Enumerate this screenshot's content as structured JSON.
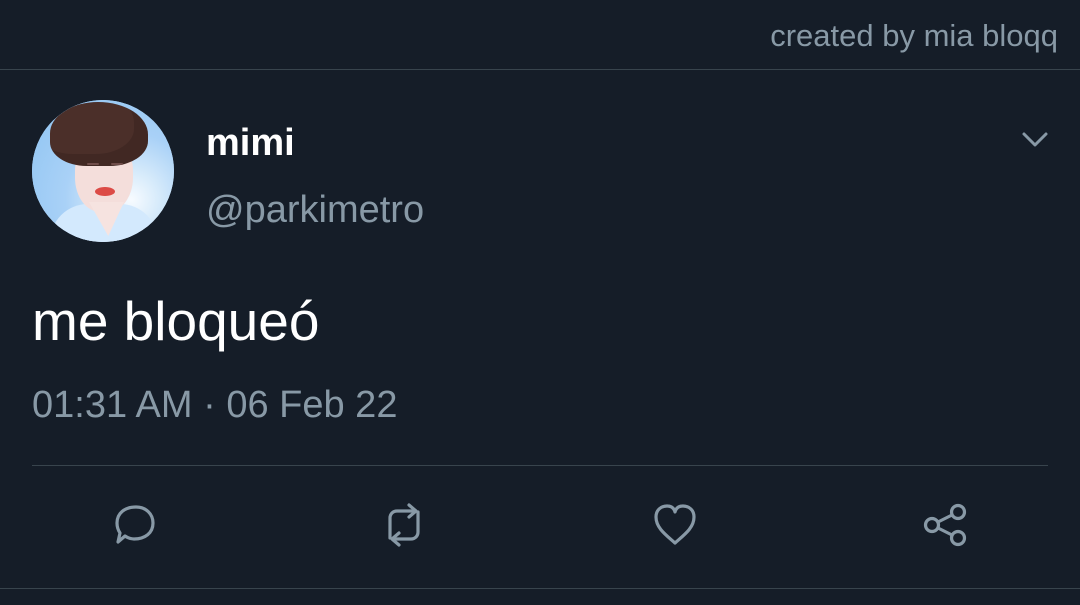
{
  "watermark": {
    "text": "created by mia bloqq"
  },
  "tweet": {
    "author_name": "mimi",
    "author_handle": "@parkimetro",
    "text": "me bloqueó",
    "timestamp": "01:31 AM · 06 Feb 22"
  },
  "icons": {
    "menu": "chevron-down-icon",
    "reply": "reply-icon",
    "retweet": "retweet-icon",
    "like": "heart-icon",
    "share": "share-icon"
  },
  "colors": {
    "background": "#151d28",
    "primary_text": "#ffffff",
    "secondary_text": "#8899a6",
    "divider": "#38444d"
  }
}
